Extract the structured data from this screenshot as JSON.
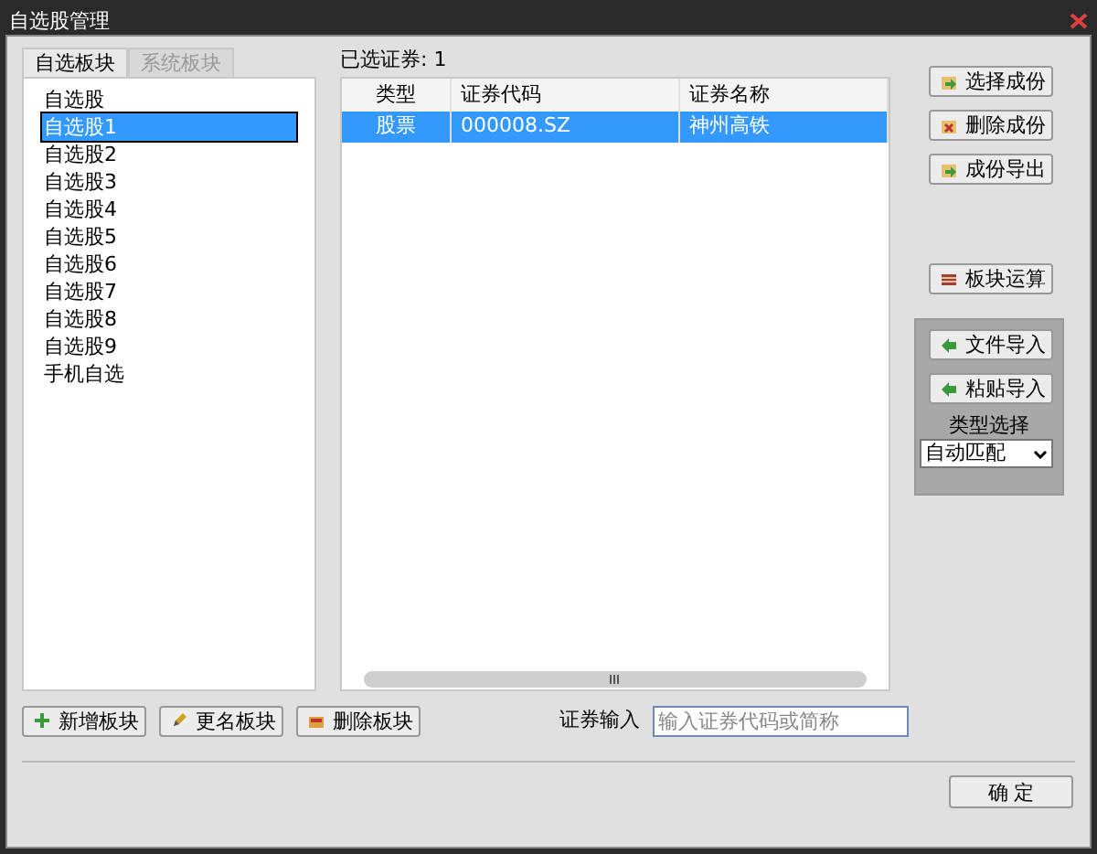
{
  "window": {
    "title": "自选股管理"
  },
  "tabs": [
    {
      "label": "自选板块",
      "selected": true
    },
    {
      "label": "系统板块",
      "selected": false
    }
  ],
  "block_list": [
    {
      "label": "自选股",
      "selected": false
    },
    {
      "label": "自选股1",
      "selected": true
    },
    {
      "label": "自选股2",
      "selected": false
    },
    {
      "label": "自选股3",
      "selected": false
    },
    {
      "label": "自选股4",
      "selected": false
    },
    {
      "label": "自选股5",
      "selected": false
    },
    {
      "label": "自选股6",
      "selected": false
    },
    {
      "label": "自选股7",
      "selected": false
    },
    {
      "label": "自选股8",
      "selected": false
    },
    {
      "label": "自选股9",
      "selected": false
    },
    {
      "label": "手机自选",
      "selected": false
    }
  ],
  "selected_count": "已选证券: 1",
  "table": {
    "columns": [
      "类型",
      "证券代码",
      "证券名称"
    ],
    "rows": [
      {
        "cells": [
          "股票",
          "000008.SZ",
          "神州高铁"
        ],
        "selected": true
      }
    ]
  },
  "side_buttons": [
    "选择成份",
    "删除成份",
    "成份导出"
  ],
  "calc_button": "板块运算",
  "import_panel": {
    "buttons": [
      "文件导入",
      "粘贴导入"
    ],
    "type_label": "类型选择",
    "type_value": "自动匹配"
  },
  "block_buttons": [
    "新增板块",
    "更名板块",
    "删除板块"
  ],
  "security_input": {
    "label": "证券输入",
    "placeholder": "输入证券代码或简称"
  },
  "ok_button": "确 定"
}
